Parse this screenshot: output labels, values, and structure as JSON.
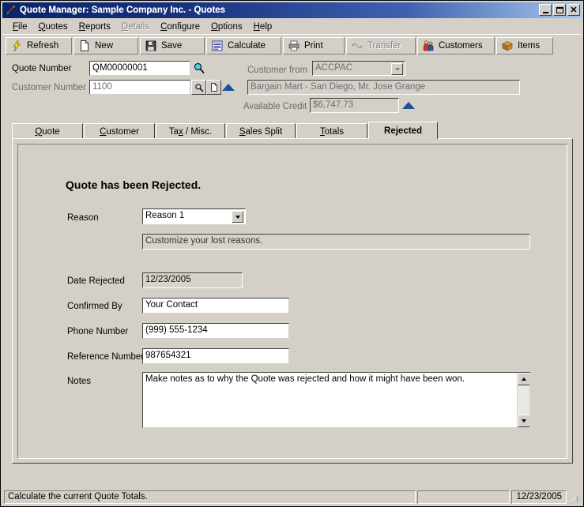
{
  "window": {
    "title": "Quote Manager: Sample Company Inc. - Quotes",
    "app_icon": "rocket-icon",
    "minimize_label": "_",
    "maximize_label": "□",
    "close_label": "×"
  },
  "menu": {
    "items": [
      {
        "label": "File",
        "accel": "F",
        "disabled": false
      },
      {
        "label": "Quotes",
        "accel": "Q",
        "disabled": false
      },
      {
        "label": "Reports",
        "accel": "R",
        "disabled": false
      },
      {
        "label": "Details",
        "accel": "D",
        "disabled": true
      },
      {
        "label": "Configure",
        "accel": "C",
        "disabled": false
      },
      {
        "label": "Options",
        "accel": "O",
        "disabled": false
      },
      {
        "label": "Help",
        "accel": "H",
        "disabled": false
      }
    ]
  },
  "toolbar": {
    "buttons": [
      {
        "label": "Refresh",
        "icon": "lightning-icon",
        "disabled": false
      },
      {
        "label": "New",
        "icon": "page-icon",
        "disabled": false
      },
      {
        "label": "Save",
        "icon": "floppy-disk-icon",
        "disabled": false
      },
      {
        "label": "Calculate",
        "icon": "calculate-icon",
        "disabled": false
      },
      {
        "label": "Print",
        "icon": "printer-icon",
        "disabled": false
      },
      {
        "label": "Transfer",
        "icon": "transfer-icon",
        "disabled": true
      },
      {
        "label": "Customers",
        "icon": "customers-icon",
        "disabled": false
      },
      {
        "label": "Items",
        "icon": "box-icon",
        "disabled": false
      }
    ]
  },
  "header": {
    "quote_number_label": "Quote Number",
    "quote_number_value": "QM00000001",
    "quote_number_search_icon": "magnifier-icon",
    "customer_number_label": "Customer Number",
    "customer_number_value": "1100",
    "customer_search_icon": "magnifier-icon",
    "customer_detail_icon": "page-icon",
    "customer_expand_icon": "blue-triangle-up-icon",
    "customer_from_label": "Customer from",
    "customer_from_value": "ACCPAC",
    "customer_name_value": "Bargain Mart - San Diego, Mr. Jose Grange",
    "available_credit_label": "Available Credit",
    "available_credit_value": "$6,747.73",
    "credit_expand_icon": "blue-triangle-up-icon"
  },
  "tabs": [
    {
      "label": "Quote",
      "accel": "Q",
      "active": false,
      "width": 90
    },
    {
      "label": "Customer",
      "accel": "C",
      "active": false,
      "width": 90
    },
    {
      "label": "Tax / Misc.",
      "accel": "x",
      "active": false,
      "width": 88
    },
    {
      "label": "Sales Split",
      "accel": "S",
      "active": false,
      "width": 88
    },
    {
      "label": "Totals",
      "accel": "T",
      "active": false,
      "width": 90
    },
    {
      "label": "Rejected",
      "accel": "",
      "active": true,
      "width": 88
    }
  ],
  "page": {
    "heading": "Quote has been Rejected.",
    "reason_label": "Reason",
    "reason_value": "Reason 1",
    "reason_hint": "Customize your lost reasons.",
    "date_rejected_label": "Date Rejected",
    "date_rejected_value": "12/23/2005",
    "confirmed_by_label": "Confirmed By",
    "confirmed_by_value": "Your Contact",
    "phone_number_label": "Phone Number",
    "phone_number_value": "(999) 555-1234",
    "reference_number_label": "Reference Number",
    "reference_number_value": "987654321",
    "notes_label": "Notes",
    "notes_value": "Make notes as to why the Quote was rejected and how it might have been won.",
    "scroll_up_icon": "scroll-up-icon",
    "scroll_down_icon": "scroll-down-icon"
  },
  "statusbar": {
    "message": "Calculate the current Quote Totals.",
    "middle": "",
    "date": "12/23/2005"
  },
  "colors": {
    "face": "#d4d0c8",
    "title_start": "#0a246a",
    "title_end": "#a6c8ec",
    "accent_blue": "#1f4e9c",
    "text": "#000000",
    "disabled_text": "#808080"
  }
}
